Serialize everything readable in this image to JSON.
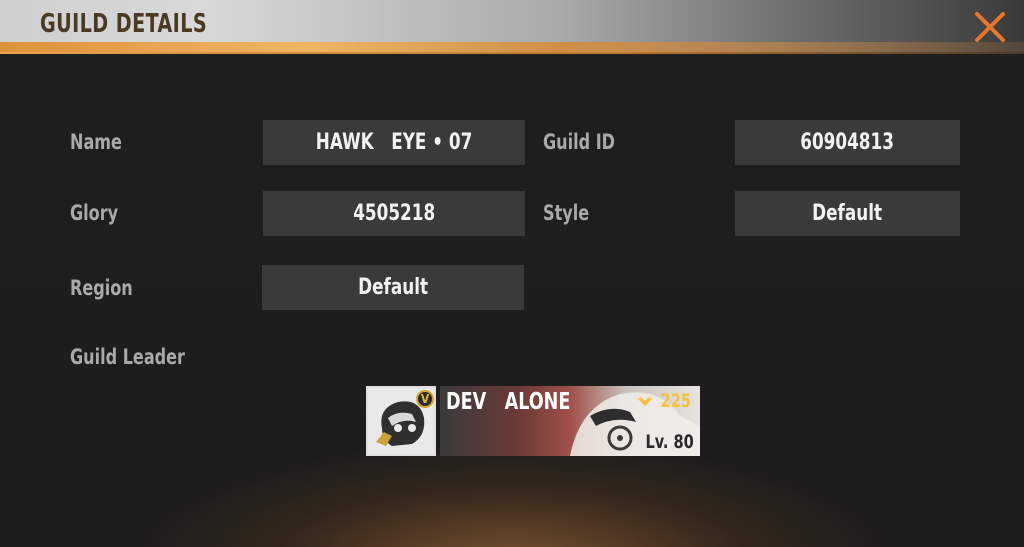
{
  "header": {
    "title": "GUILD DETAILS",
    "close_icon": "close-icon"
  },
  "fields": {
    "name": {
      "label": "Name",
      "value": "HAWK   EYE • 07"
    },
    "guild_id": {
      "label": "Guild ID",
      "value": "60904813"
    },
    "glory": {
      "label": "Glory",
      "value": "4505218"
    },
    "style": {
      "label": "Style",
      "value": "Default"
    },
    "region": {
      "label": "Region",
      "value": "Default"
    }
  },
  "leader": {
    "label": "Guild Leader",
    "name": "DEV   ALONE",
    "likes": "225",
    "level": "Lv. 80",
    "badge": "V"
  },
  "colors": {
    "accent": "#e8772e",
    "field_bg": "#3a3a3a",
    "label": "#a9a9a9",
    "likes": "#f5c23a"
  }
}
